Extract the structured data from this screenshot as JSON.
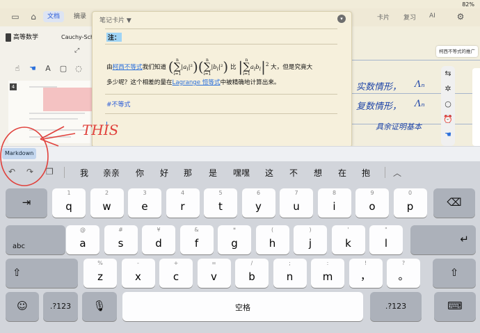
{
  "status": {
    "battery": "82%"
  },
  "toolbar": {
    "tab_docs": "文档",
    "tab_excerpts": "摘录",
    "card_tab": "卡片",
    "review_tab": "复习",
    "ai_tab": "AI"
  },
  "left_pane": {
    "book_title": "高等数学",
    "doc_title": "Cauchy-Sch",
    "badge_count": "4"
  },
  "note_card": {
    "header": "笔记卡片 ▼",
    "label": "注：",
    "line1_prefix": "由",
    "line1_link": "柯西不等式",
    "line1_mid": "我们知道",
    "line1_compare": "比",
    "line1_suffix": "大，但是究竟大",
    "line2_prefix": "多少呢？这个相差的量在",
    "line2_link": "Lagrange 恒等式",
    "line2_suffix": "中被精确地计算出来。",
    "tag": "#不等式"
  },
  "right_pane": {
    "callout": "柯西不等式的推广",
    "hand1": "实数情形，",
    "hand2": "复数情形，",
    "hand3": "具余证明基本"
  },
  "annotation": {
    "text": "THIS"
  },
  "accessory": {
    "markdown_button": "Markdown"
  },
  "candidates": [
    "我",
    "亲亲",
    "你",
    "好",
    "那",
    "是",
    "嘿嘿",
    "这",
    "不",
    "想",
    "在",
    "抱"
  ],
  "keyboard": {
    "row1": [
      [
        "1",
        "q"
      ],
      [
        "2",
        "w"
      ],
      [
        "3",
        "e"
      ],
      [
        "4",
        "r"
      ],
      [
        "5",
        "t"
      ],
      [
        "6",
        "y"
      ],
      [
        "7",
        "u"
      ],
      [
        "8",
        "i"
      ],
      [
        "9",
        "o"
      ],
      [
        "0",
        "p"
      ]
    ],
    "row2": [
      [
        "@",
        "a"
      ],
      [
        "#",
        "s"
      ],
      [
        "¥",
        "d"
      ],
      [
        "&",
        "f"
      ],
      [
        "*",
        "g"
      ],
      [
        "(",
        "h"
      ],
      [
        ")",
        "j"
      ],
      [
        "'",
        "k"
      ],
      [
        "\"",
        "l"
      ]
    ],
    "row3": [
      [
        "%",
        "z"
      ],
      [
        "-",
        "x"
      ],
      [
        "+",
        "c"
      ],
      [
        "=",
        "v"
      ],
      [
        "/",
        "b"
      ],
      [
        ";",
        "n"
      ],
      [
        ":",
        "m"
      ],
      [
        "!",
        "，"
      ],
      [
        "?",
        "。"
      ]
    ],
    "tab_label": "⇥",
    "abc_label": "abc",
    "space_label": "空格",
    "num_label": ".?123"
  },
  "colors": {
    "accent": "#2a6fdb",
    "highlight": "#9fd4f5",
    "annotation": "#e0403b"
  }
}
